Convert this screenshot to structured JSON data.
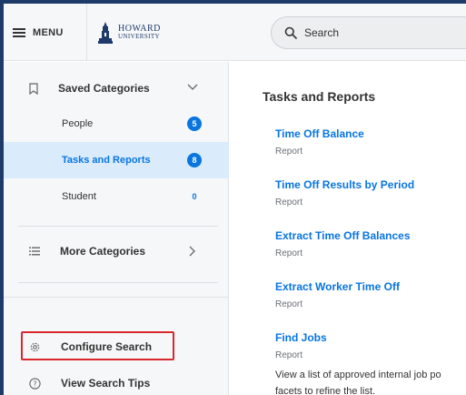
{
  "header": {
    "menu_label": "MENU",
    "logo_line1": "HOWARD",
    "logo_line2": "UNIVERSITY",
    "search_placeholder": "Search"
  },
  "sidebar": {
    "saved_categories": "Saved Categories",
    "items": [
      {
        "label": "People",
        "count": "5"
      },
      {
        "label": "Tasks and Reports",
        "count": "8"
      },
      {
        "label": "Student",
        "count": "0"
      }
    ],
    "more_categories": "More Categories",
    "configure_search": "Configure Search",
    "view_search_tips": "View Search Tips"
  },
  "main": {
    "heading": "Tasks and Reports",
    "results": [
      {
        "title": "Time Off Balance",
        "type": "Report"
      },
      {
        "title": "Time Off Results by Period",
        "type": "Report"
      },
      {
        "title": "Extract Time Off Balances",
        "type": "Report"
      },
      {
        "title": "Extract Worker Time Off",
        "type": "Report"
      },
      {
        "title": "Find Jobs",
        "type": "Report",
        "desc_line1": "View a list of approved internal job po",
        "desc_line2": "facets to refine the list."
      }
    ]
  },
  "colors": {
    "accent": "#0875e1",
    "highlight_box": "#d9292f",
    "active_bg": "#daebfb"
  }
}
